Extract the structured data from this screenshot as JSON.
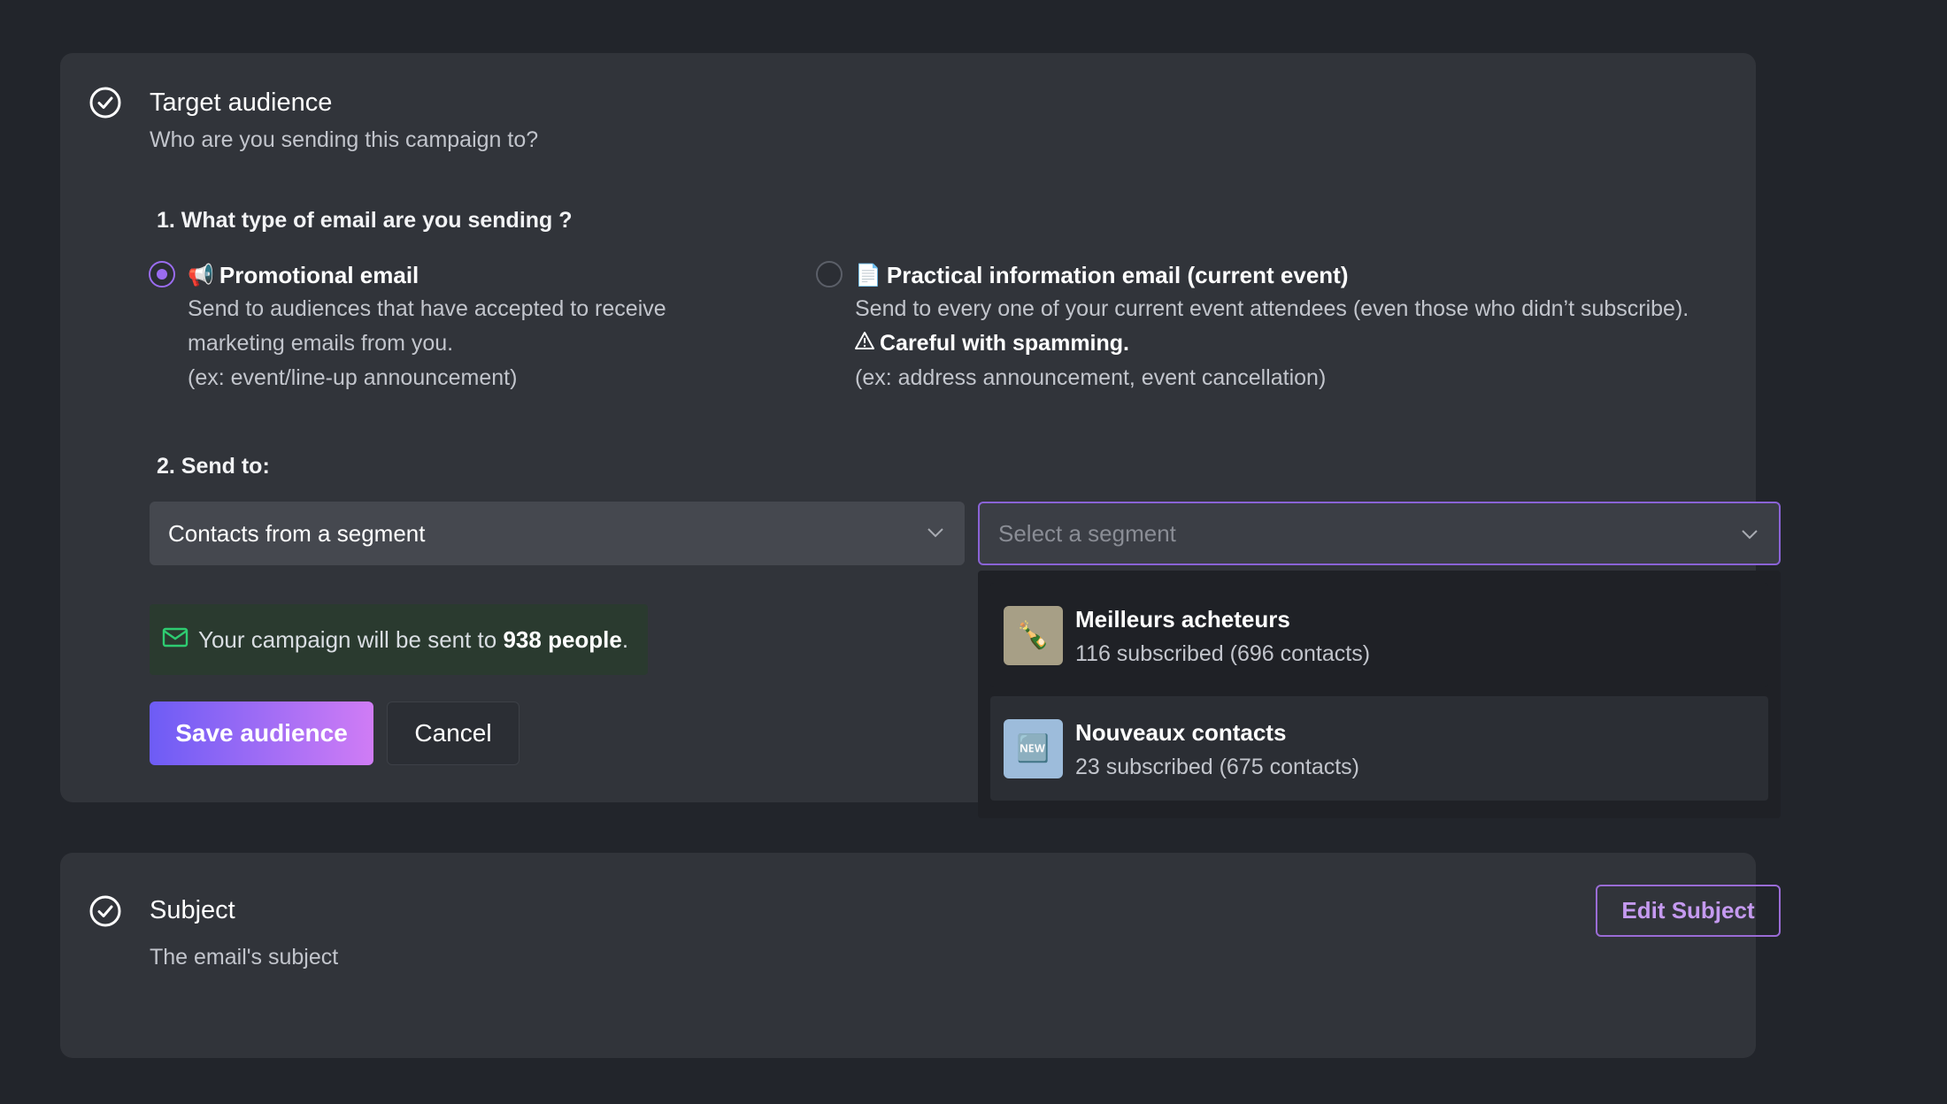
{
  "audience": {
    "title": "Target audience",
    "subtitle": "Who are you sending this campaign to?",
    "q1_label": "1. What type of email are you sending ?",
    "options": [
      {
        "emoji": "📢",
        "title": "Promotional email",
        "desc_lines": [
          "Send to audiences that have accepted to receive",
          "marketing emails from you.",
          "(ex: event/line-up announcement)"
        ],
        "checked": true
      },
      {
        "emoji": "📄",
        "title": "Practical information email (current event)",
        "desc_line1": "Send to every one of your current event attendees (even those who didn’t subscribe).",
        "warning": "Careful with spamming.",
        "desc_line3": "(ex: address announcement, event cancellation)",
        "checked": false
      }
    ],
    "q2_label": "2. Send to:",
    "send_to_value": "Contacts from a segment",
    "segment_placeholder": "Select a segment",
    "segments": [
      {
        "icon": "🍾",
        "name": "Meilleurs acheteurs",
        "meta": "116 subscribed (696 contacts)",
        "thumb_color": "#a79f86"
      },
      {
        "icon": "🆕",
        "name": "Nouveaux contacts",
        "meta": "23 subscribed (675 contacts)",
        "thumb_color": "#9dbcdb"
      }
    ],
    "notice_prefix": "Your campaign will be sent to ",
    "notice_count": "938 people",
    "notice_suffix": ".",
    "save_label": "Save audience",
    "cancel_label": "Cancel"
  },
  "subject": {
    "title": "Subject",
    "subtitle": "The email's subject",
    "edit_label": "Edit Subject"
  },
  "colors": {
    "accent": "#9a6cf0",
    "background": "#22252b",
    "card": "#31343a",
    "notice_bg": "#2a3a2f",
    "success_icon": "#2ecc71"
  }
}
